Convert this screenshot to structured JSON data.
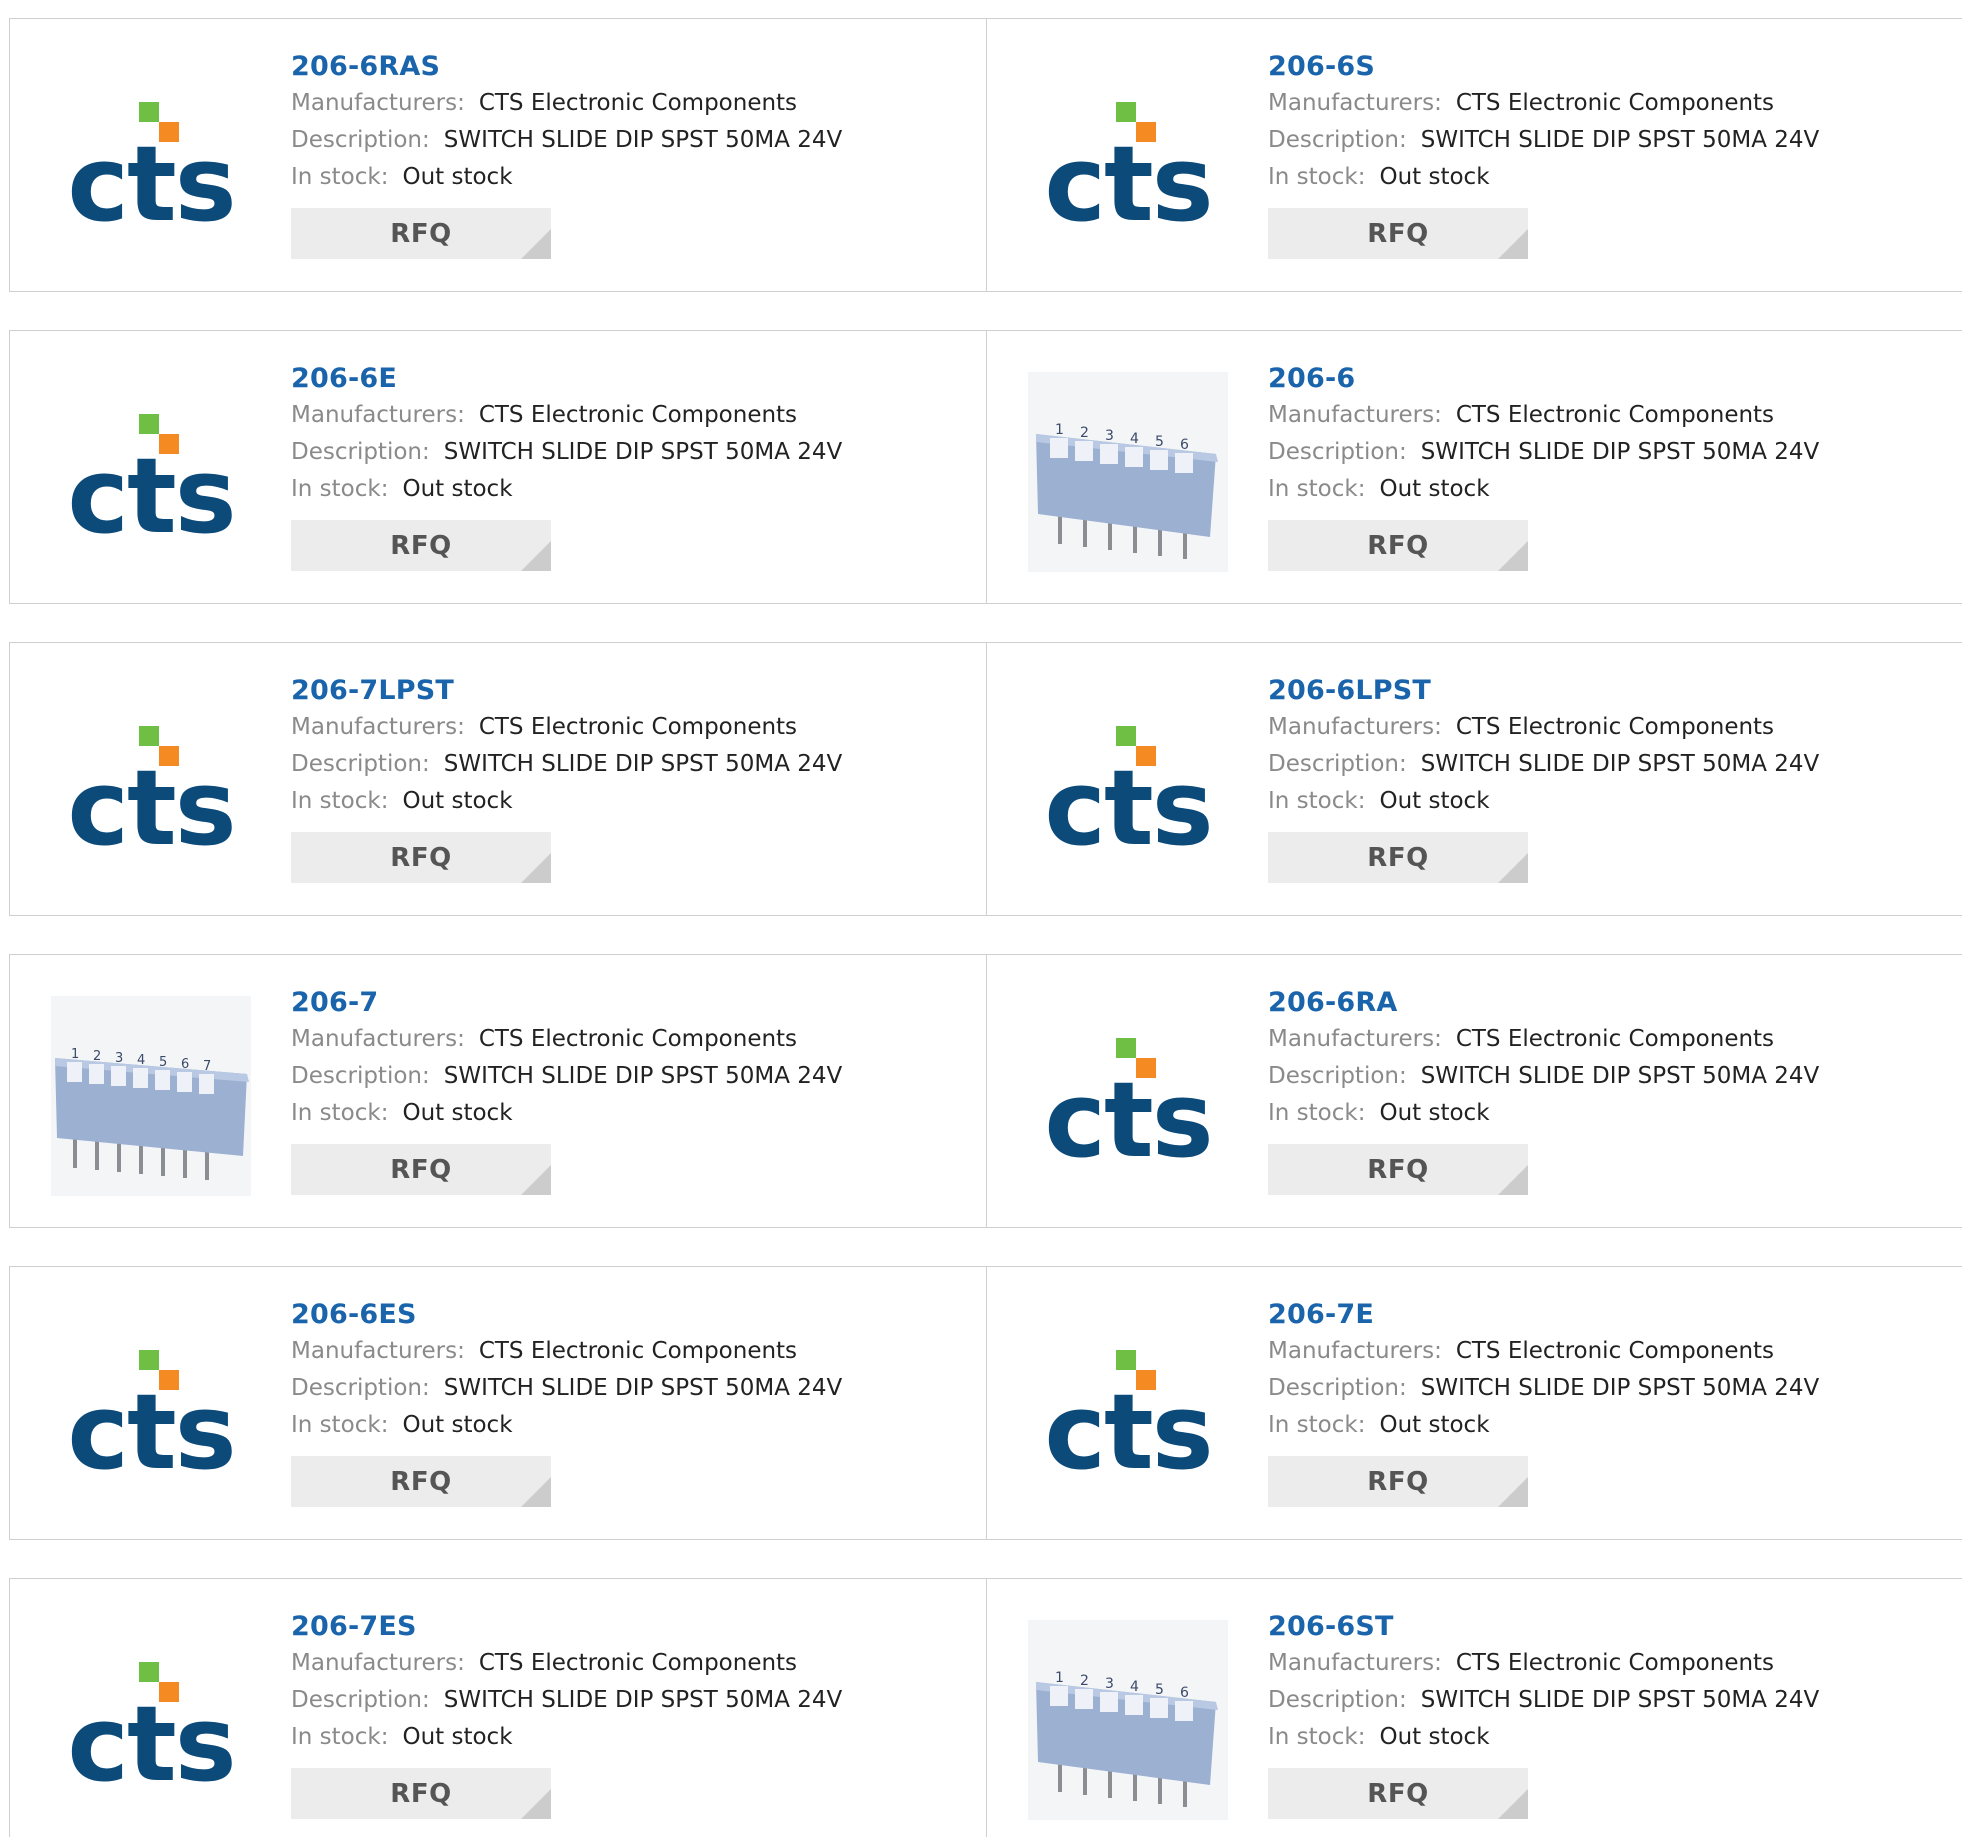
{
  "labels": {
    "manufacturers": "Manufacturers:",
    "description": "Description:",
    "in_stock": "In stock:",
    "rfq": "RFQ"
  },
  "brand_colors": {
    "cts_blue": "#0c4a7a",
    "cts_green": "#6fbf44",
    "cts_orange": "#f48a21",
    "link": "#1a64ab"
  },
  "products": [
    {
      "part": "206-6RAS",
      "manufacturer": "CTS Electronic Components",
      "description": "SWITCH SLIDE DIP SPST 50MA 24V",
      "stock": "Out stock",
      "image": "cts-logo"
    },
    {
      "part": "206-6S",
      "manufacturer": "CTS Electronic Components",
      "description": "SWITCH SLIDE DIP SPST 50MA 24V",
      "stock": "Out stock",
      "image": "cts-logo"
    },
    {
      "part": "206-6E",
      "manufacturer": "CTS Electronic Components",
      "description": "SWITCH SLIDE DIP SPST 50MA 24V",
      "stock": "Out stock",
      "image": "cts-logo"
    },
    {
      "part": "206-6",
      "manufacturer": "CTS Electronic Components",
      "description": "SWITCH SLIDE DIP SPST 50MA 24V",
      "stock": "Out stock",
      "image": "dip-switch-6"
    },
    {
      "part": "206-7LPST",
      "manufacturer": "CTS Electronic Components",
      "description": "SWITCH SLIDE DIP SPST 50MA 24V",
      "stock": "Out stock",
      "image": "cts-logo"
    },
    {
      "part": "206-6LPST",
      "manufacturer": "CTS Electronic Components",
      "description": "SWITCH SLIDE DIP SPST 50MA 24V",
      "stock": "Out stock",
      "image": "cts-logo"
    },
    {
      "part": "206-7",
      "manufacturer": "CTS Electronic Components",
      "description": "SWITCH SLIDE DIP SPST 50MA 24V",
      "stock": "Out stock",
      "image": "dip-switch-7"
    },
    {
      "part": "206-6RA",
      "manufacturer": "CTS Electronic Components",
      "description": "SWITCH SLIDE DIP SPST 50MA 24V",
      "stock": "Out stock",
      "image": "cts-logo"
    },
    {
      "part": "206-6ES",
      "manufacturer": "CTS Electronic Components",
      "description": "SWITCH SLIDE DIP SPST 50MA 24V",
      "stock": "Out stock",
      "image": "cts-logo"
    },
    {
      "part": "206-7E",
      "manufacturer": "CTS Electronic Components",
      "description": "SWITCH SLIDE DIP SPST 50MA 24V",
      "stock": "Out stock",
      "image": "cts-logo"
    },
    {
      "part": "206-7ES",
      "manufacturer": "CTS Electronic Components",
      "description": "SWITCH SLIDE DIP SPST 50MA 24V",
      "stock": "Out stock",
      "image": "cts-logo"
    },
    {
      "part": "206-6ST",
      "manufacturer": "CTS Electronic Components",
      "description": "SWITCH SLIDE DIP SPST 50MA 24V",
      "stock": "Out stock",
      "image": "dip-switch-6"
    }
  ]
}
